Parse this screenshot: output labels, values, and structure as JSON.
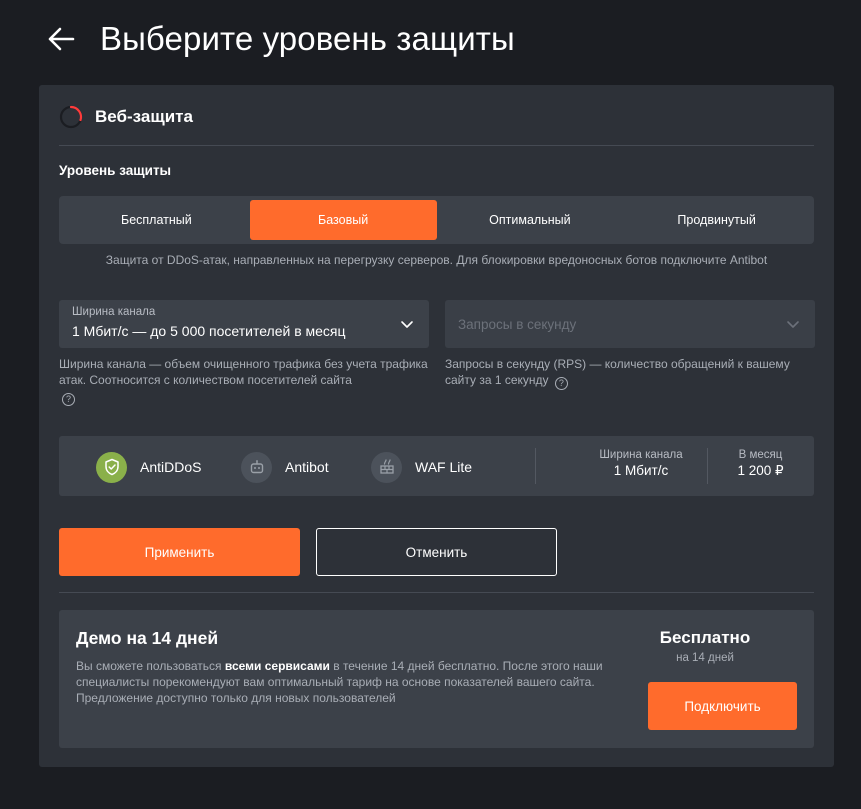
{
  "header": {
    "title": "Выберите уровень защиты"
  },
  "section": {
    "title": "Веб-защита"
  },
  "level": {
    "label": "Уровень защиты",
    "tabs": [
      {
        "label": "Бесплатный",
        "active": false
      },
      {
        "label": "Базовый",
        "active": true
      },
      {
        "label": "Оптимальный",
        "active": false
      },
      {
        "label": "Продвинутый",
        "active": false
      }
    ],
    "description": "Защита от DDoS-атак, направленных на перегрузку серверов. Для блокировки вредоносных ботов подключите Antibot"
  },
  "bandwidth": {
    "label": "Ширина канала",
    "value": "1 Мбит/с — до 5 000 посетителей в месяц",
    "help": "Ширина канала — объем очищенного трафика без учета трафика атак. Соотносится с количеством посетителей сайта"
  },
  "rps": {
    "placeholder": "Запросы в секунду",
    "help": "Запросы в секунду (RPS) — количество обращений к вашему сайту за 1 секунду"
  },
  "summary": {
    "services": [
      {
        "name": "AntiDDoS",
        "icon": "shield-check-icon",
        "active": true
      },
      {
        "name": "Antibot",
        "icon": "robot-icon",
        "active": false
      },
      {
        "name": "WAF Lite",
        "icon": "firewall-icon",
        "active": false
      }
    ],
    "bandwidth_label": "Ширина канала",
    "bandwidth_value": "1 Мбит/с",
    "price_label": "В месяц",
    "price_value": "1 200 ₽"
  },
  "actions": {
    "apply": "Применить",
    "cancel": "Отменить"
  },
  "demo": {
    "title": "Демо на 14 дней",
    "text_before": "Вы сможете пользоваться ",
    "text_bold": "всеми сервисами",
    "text_after": " в течение 14 дней бесплатно. После этого наши специалисты порекомендуют вам оптимальный тариф на основе показателей вашего сайта. Предложение доступно только для новых пользователей",
    "price": "Бесплатно",
    "period": "на 14 дней",
    "connect": "Подключить"
  },
  "colors": {
    "accent": "#ff6b2c",
    "background": "#1b1d22",
    "panel": "#2d3138",
    "active_service": "#8ab04a"
  }
}
